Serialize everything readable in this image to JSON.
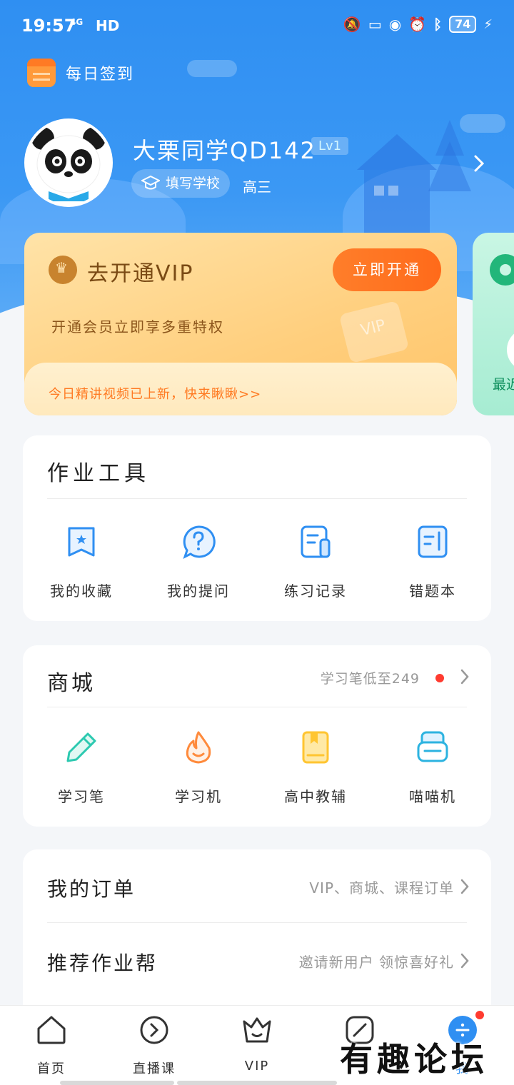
{
  "status_bar": {
    "time": "19:57",
    "network": "4G",
    "hd": "HD",
    "battery": "74"
  },
  "checkin": {
    "label": "每日签到"
  },
  "profile": {
    "name": "大栗同学QD142",
    "level": "Lv1",
    "school_button": "填写学校",
    "grade": "高三"
  },
  "vip_card": {
    "title": "去开通VIP",
    "subtitle": "开通会员立即享多重特权",
    "button": "立即开通",
    "watermark": "VIP",
    "promo": "今日精讲视频已上新，快来瞅瞅>>"
  },
  "side_card": {
    "text": "最近"
  },
  "homework_tools": {
    "title": "作业工具",
    "items": [
      {
        "label": "我的收藏",
        "icon": "bookmark-icon"
      },
      {
        "label": "我的提问",
        "icon": "question-bubble-icon"
      },
      {
        "label": "练习记录",
        "icon": "practice-record-icon"
      },
      {
        "label": "错题本",
        "icon": "mistake-book-icon"
      }
    ]
  },
  "mall": {
    "title": "商城",
    "note": "学习笔低至249",
    "items": [
      {
        "label": "学习笔",
        "icon": "pen-icon"
      },
      {
        "label": "学习机",
        "icon": "flame-icon"
      },
      {
        "label": "高中教辅",
        "icon": "book-icon"
      },
      {
        "label": "喵喵机",
        "icon": "printer-icon"
      }
    ]
  },
  "list_rows": [
    {
      "title": "我的订单",
      "note": "VIP、商城、课程订单"
    },
    {
      "title": "推荐作业帮",
      "note": "邀请新用户 领惊喜好礼"
    }
  ],
  "tabbar": [
    {
      "label": "首页",
      "icon": "home-icon"
    },
    {
      "label": "直播课",
      "icon": "play-icon"
    },
    {
      "label": "VIP",
      "icon": "crown-icon"
    },
    {
      "label": "",
      "icon": "pencil-icon"
    },
    {
      "label": "我",
      "icon": "me-icon"
    }
  ],
  "watermark_logo": "有趣论坛",
  "colors": {
    "primary": "#2f8ff2",
    "vip_button": "#ff6a1a",
    "promo_text": "#ff7a22",
    "icon_blue": "#2f8ff2",
    "icon_teal": "#2cc9b0",
    "icon_orange": "#ff8a3b",
    "icon_yellow": "#ffc531"
  }
}
